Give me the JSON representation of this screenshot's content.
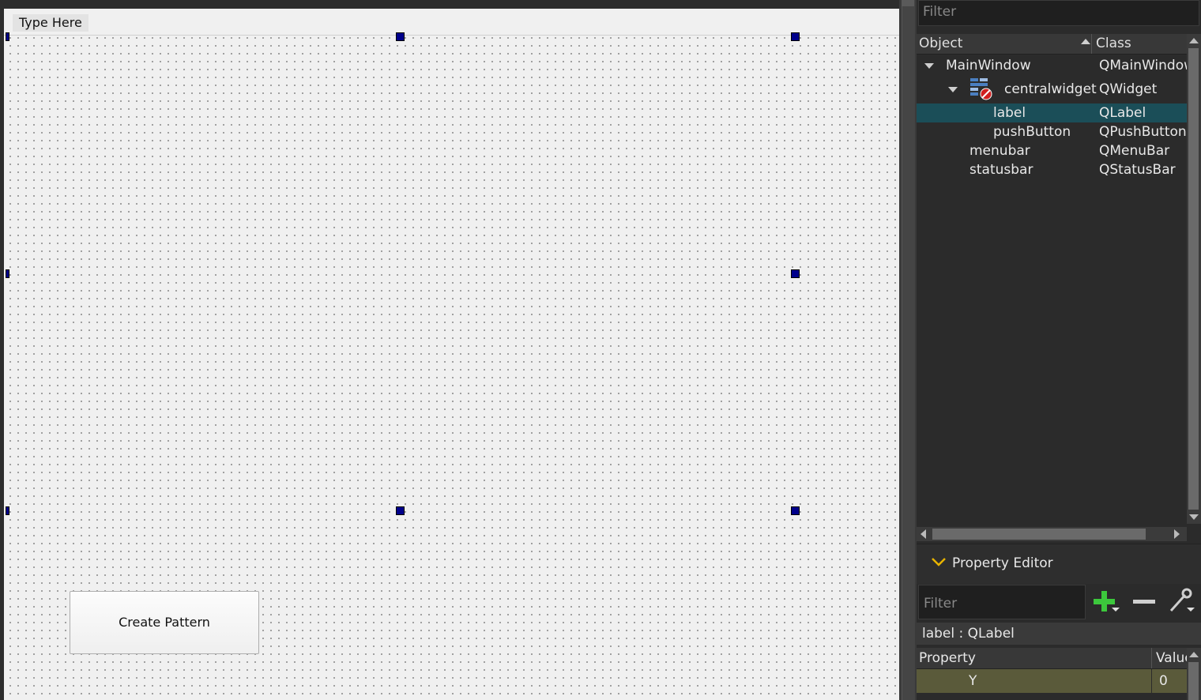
{
  "form": {
    "menu_placeholder": "Type Here",
    "button_label": "Create Pattern"
  },
  "object_inspector": {
    "filter_placeholder": "Filter",
    "columns": {
      "object": "Object",
      "class": "Class"
    },
    "rows": [
      {
        "object": "MainWindow",
        "class": "QMainWindow",
        "expanded": true
      },
      {
        "object": "centralwidget",
        "class": "QWidget",
        "expanded": true
      },
      {
        "object": "label",
        "class": "QLabel",
        "selected": true
      },
      {
        "object": "pushButton",
        "class": "QPushButton"
      },
      {
        "object": "menubar",
        "class": "QMenuBar"
      },
      {
        "object": "statusbar",
        "class": "QStatusBar"
      }
    ]
  },
  "property_editor": {
    "title": "Property Editor",
    "filter_placeholder": "Filter",
    "context": "label : QLabel",
    "columns": {
      "property": "Property",
      "value": "Value"
    },
    "rows": [
      {
        "property": "Y",
        "value": "0"
      }
    ]
  },
  "colors": {
    "selection": "#1b4e58",
    "handle": "#00008b",
    "property_row": "#5a5a3a"
  }
}
